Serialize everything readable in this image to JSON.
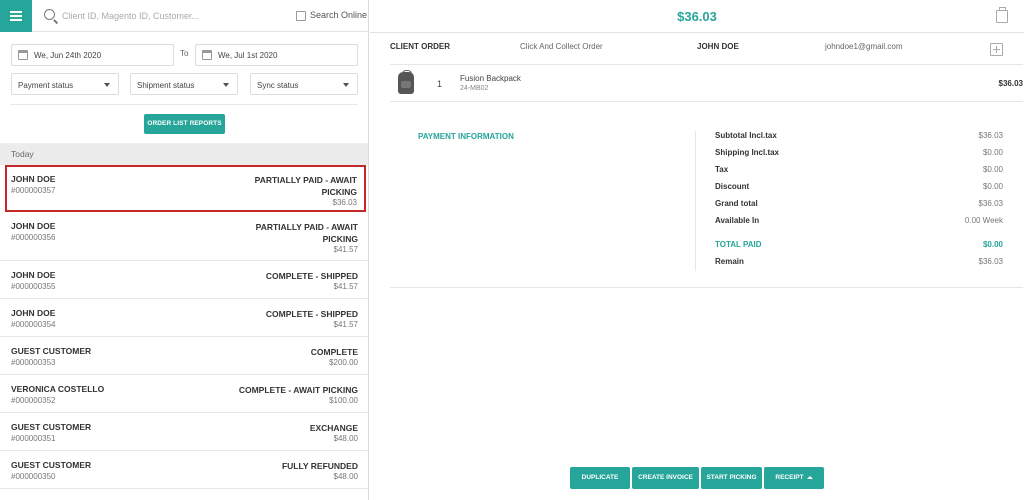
{
  "search": {
    "placeholder": "Client ID, Magento ID, Customer...",
    "online_label": "Search Online"
  },
  "filters": {
    "date_from": "We, Jun 24th 2020",
    "to_label": "To",
    "date_to": "We, Jul 1st 2020",
    "payment_status": "Payment status",
    "shipment_status": "Shipment status",
    "sync_status": "Sync status",
    "report_button": "ORDER LIST REPORTS"
  },
  "group_header": "Today",
  "orders": [
    {
      "customer": "JOHN DOE",
      "number": "#000000357",
      "status": "PARTIALLY PAID - AWAIT PICKING",
      "amount": "$36.03"
    },
    {
      "customer": "JOHN DOE",
      "number": "#000000356",
      "status": "PARTIALLY PAID - AWAIT PICKING",
      "amount": "$41.57"
    },
    {
      "customer": "JOHN DOE",
      "number": "#000000355",
      "status": "COMPLETE - SHIPPED",
      "amount": "$41.57"
    },
    {
      "customer": "JOHN DOE",
      "number": "#000000354",
      "status": "COMPLETE - SHIPPED",
      "amount": "$41.57"
    },
    {
      "customer": "GUEST CUSTOMER",
      "number": "#000000353",
      "status": "COMPLETE",
      "amount": "$200.00"
    },
    {
      "customer": "VERONICA COSTELLO",
      "number": "#000000352",
      "status": "COMPLETE - AWAIT PICKING",
      "amount": "$100.00"
    },
    {
      "customer": "GUEST CUSTOMER",
      "number": "#000000351",
      "status": "EXCHANGE",
      "amount": "$48.00"
    },
    {
      "customer": "GUEST CUSTOMER",
      "number": "#000000350",
      "status": "FULLY REFUNDED",
      "amount": "$48.00"
    }
  ],
  "detail": {
    "total": "$36.03",
    "client_order_label": "CLIENT ORDER",
    "order_type": "Click And Collect Order",
    "customer_name": "JOHN DOE",
    "customer_email": "johndoe1@gmail.com",
    "item": {
      "qty": "1",
      "name": "Fusion Backpack",
      "sku": "24-MB02",
      "price": "$36.03"
    },
    "payment_info_label": "PAYMENT INFORMATION",
    "totals": {
      "subtotal_label": "Subtotal Incl.tax",
      "subtotal": "$36.03",
      "shipping_label": "Shipping Incl.tax",
      "shipping": "$0.00",
      "tax_label": "Tax",
      "tax": "$0.00",
      "discount_label": "Discount",
      "discount": "$0.00",
      "grand_total_label": "Grand total",
      "grand_total": "$36.03",
      "available_label": "Available In",
      "available": "0.00 Week",
      "total_paid_label": "TOTAL PAID",
      "total_paid": "$0.00",
      "remain_label": "Remain",
      "remain": "$36.03"
    }
  },
  "actions": {
    "duplicate": "DUPLICATE",
    "create_invoice": "CREATE INVOICE",
    "start_picking": "START PICKING",
    "receipt": "RECEIPT"
  },
  "colors": {
    "accent": "#26a69a",
    "selection_border": "#c62828"
  }
}
